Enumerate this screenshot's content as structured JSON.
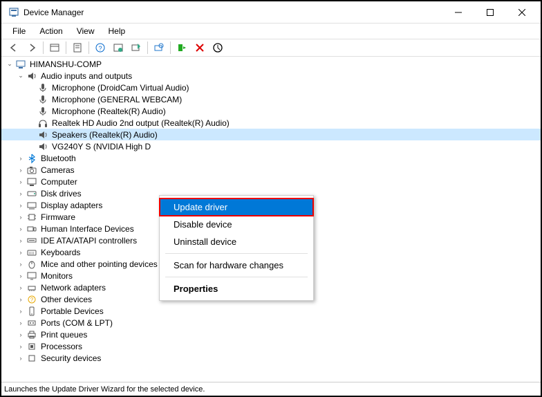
{
  "window": {
    "title": "Device Manager"
  },
  "menubar": {
    "file": "File",
    "action": "Action",
    "view": "View",
    "help": "Help"
  },
  "tree": {
    "root": "HIMANSHU-COMP",
    "audio_category": "Audio inputs and outputs",
    "audio_devices": {
      "d0": "Microphone (DroidCam Virtual Audio)",
      "d1": "Microphone (GENERAL WEBCAM)",
      "d2": "Microphone (Realtek(R) Audio)",
      "d3": "Realtek HD Audio 2nd output (Realtek(R) Audio)",
      "d4": "Speakers (Realtek(R) Audio)",
      "d5": "VG240Y S (NVIDIA High D"
    },
    "categories": {
      "bluetooth": "Bluetooth",
      "cameras": "Cameras",
      "computer": "Computer",
      "disk_drives": "Disk drives",
      "display_adapters": "Display adapters",
      "firmware": "Firmware",
      "hid": "Human Interface Devices",
      "ide": "IDE ATA/ATAPI controllers",
      "keyboards": "Keyboards",
      "mice": "Mice and other pointing devices",
      "monitors": "Monitors",
      "network": "Network adapters",
      "other": "Other devices",
      "portable": "Portable Devices",
      "ports": "Ports (COM & LPT)",
      "print_queues": "Print queues",
      "processors": "Processors",
      "security": "Security devices"
    }
  },
  "context_menu": {
    "update_driver": "Update driver",
    "disable_device": "Disable device",
    "uninstall_device": "Uninstall device",
    "scan_hardware": "Scan for hardware changes",
    "properties": "Properties"
  },
  "statusbar": {
    "text": "Launches the Update Driver Wizard for the selected device."
  }
}
